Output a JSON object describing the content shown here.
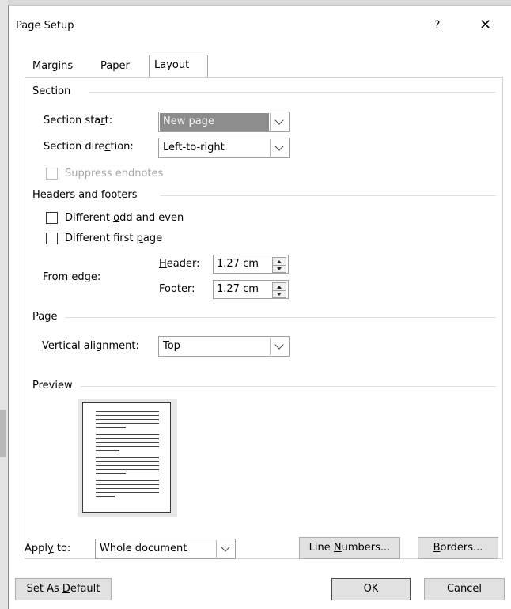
{
  "dialog": {
    "title": "Page Setup",
    "help_label": "?",
    "close_label": "✕"
  },
  "tabs": [
    {
      "label": "Margins"
    },
    {
      "label": "Paper"
    },
    {
      "label": "Layout",
      "active": true
    }
  ],
  "section": {
    "header": "Section",
    "start_label": [
      "Section sta",
      "r",
      "t:"
    ],
    "start_value": "New page",
    "direction_label": [
      "Section dire",
      "c",
      "tion:"
    ],
    "direction_value": "Left-to-right",
    "suppress_endnotes": "Suppress endnotes"
  },
  "headers_footers": {
    "header": "Headers and footers",
    "odd_even": [
      "Different ",
      "o",
      "dd and even"
    ],
    "first_page": [
      "Different first ",
      "p",
      "age"
    ],
    "from_edge": "From edge:",
    "header_label": [
      "",
      "H",
      "eader:"
    ],
    "header_value": "1.27 cm",
    "footer_label": [
      "",
      "F",
      "ooter:"
    ],
    "footer_value": "1.27 cm"
  },
  "page": {
    "header": "Page",
    "valign_label": [
      "",
      "V",
      "ertical alignment:"
    ],
    "valign_value": "Top"
  },
  "preview": {
    "header": "Preview"
  },
  "apply": {
    "label": [
      "Appl",
      "y",
      " to:"
    ],
    "value": "Whole document"
  },
  "buttons": {
    "line_numbers": [
      "Line ",
      "N",
      "umbers..."
    ],
    "borders": [
      "",
      "B",
      "orders..."
    ],
    "set_default": [
      "Set As ",
      "D",
      "efault"
    ],
    "ok": "OK",
    "cancel": "Cancel"
  }
}
